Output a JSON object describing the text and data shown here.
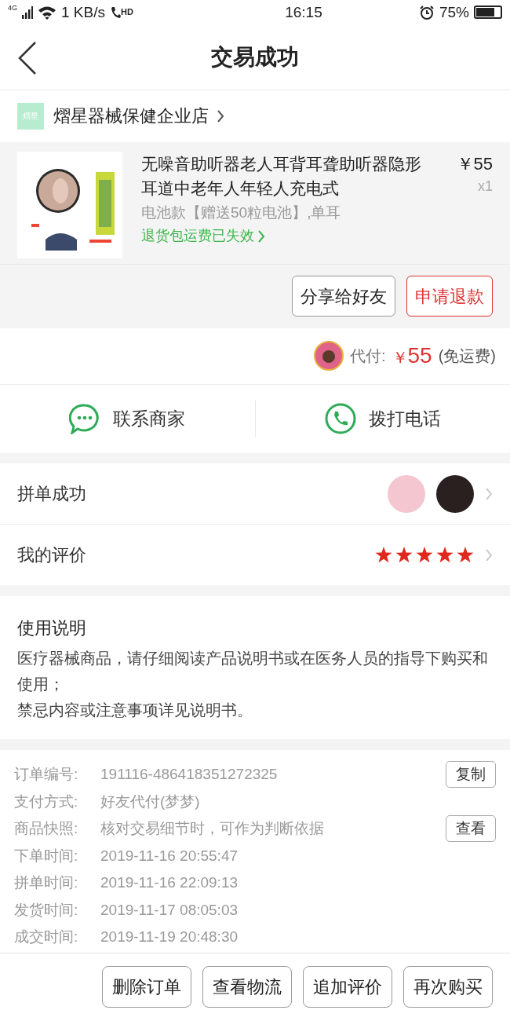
{
  "status_bar": {
    "network": "4G",
    "speed": "1 KB/s",
    "hd": "HD",
    "time": "16:15",
    "battery": "75%"
  },
  "header": {
    "title": "交易成功"
  },
  "shop": {
    "logo_text": "熠星",
    "name": "熠星器械保健企业店"
  },
  "product": {
    "title": "无噪音助听器老人耳背耳聋助听器隐形耳道中老年人年轻人充电式",
    "price": "￥55",
    "quantity": "x1",
    "variant": "电池款【赠送50粒电池】,单耳",
    "return_note": "退货包运费已失效"
  },
  "product_actions": [
    {
      "label": "分享给好友",
      "kind": "plain"
    },
    {
      "label": "申请退款",
      "kind": "accent"
    }
  ],
  "payment": {
    "label": "代付:",
    "currency": "￥",
    "amount": "55",
    "note": "(免运费)"
  },
  "contact": [
    {
      "label": "联系商家",
      "kind": "chat"
    },
    {
      "label": "拨打电话",
      "kind": "phone"
    }
  ],
  "group_buy": {
    "label": "拼单成功",
    "avatars": [
      {
        "color": "#f4c6cf"
      },
      {
        "color": "#2a2020"
      }
    ]
  },
  "review": {
    "label": "我的评价",
    "stars": 5
  },
  "instructions": {
    "title": "使用说明",
    "lines": [
      "医疗器械商品，请仔细阅读产品说明书或在医务人员的指导下购买和使用；",
      "禁忌内容或注意事项详见说明书。"
    ]
  },
  "order_info": [
    {
      "label": "订单编号:",
      "value": "191116-486418351272325",
      "action": "复制"
    },
    {
      "label": "支付方式:",
      "value": "好友代付(梦梦)"
    },
    {
      "label": "商品快照:",
      "value": "核对交易细节时，可作为判断依据",
      "action": "查看"
    },
    {
      "label": "下单时间:",
      "value": "2019-11-16 20:55:47"
    },
    {
      "label": "拼单时间:",
      "value": "2019-11-16 22:09:13"
    },
    {
      "label": "发货时间:",
      "value": "2019-11-17 08:05:03"
    },
    {
      "label": "成交时间:",
      "value": "2019-11-19 20:48:30"
    }
  ],
  "bottom_actions": [
    "删除订单",
    "查看物流",
    "追加评价",
    "再次购买"
  ]
}
